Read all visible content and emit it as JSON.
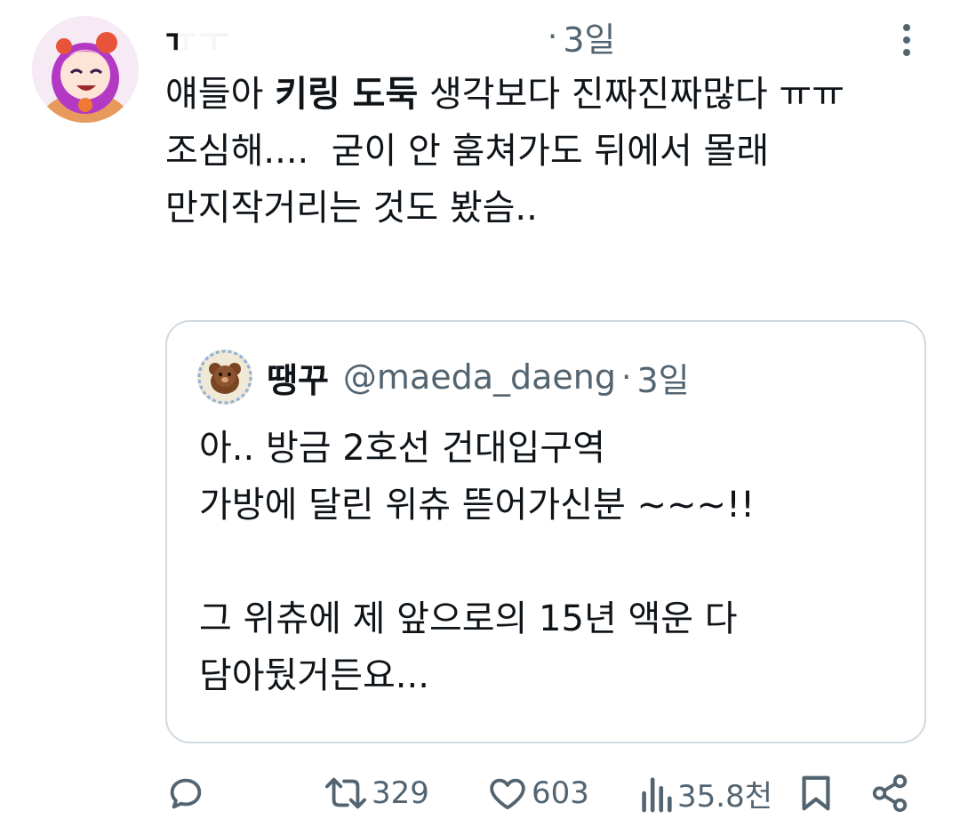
{
  "tweet": {
    "display_name": "ㅠㅜ",
    "dot": "·",
    "time": "3일",
    "text_lines": [
      {
        "pre": "얘들아 ",
        "strong": "키링 도둑",
        "post": " 생각보다 진짜진짜많다 ㅠㅠ"
      },
      {
        "pre": "조심해....  굳이 안 훔쳐가도 뒤에서 몰래 만지작거리는 것도 봤슴..",
        "strong": "",
        "post": ""
      }
    ]
  },
  "quote": {
    "name": "땡꾸",
    "handle": "@maeda_daeng",
    "dot": "·",
    "time": "3일",
    "text": "아.. 방금 2호선 건대입구역\n가방에 달린 위츄 뜯어가신분 ~~~!!\n\n그 위츄에 제 앞으로의 15년 액운 다\n담아뒀거든요..."
  },
  "actions": {
    "reply": {
      "icon": "reply-icon",
      "count": ""
    },
    "retweet": {
      "icon": "retweet-icon",
      "count": "329"
    },
    "like": {
      "icon": "heart-icon",
      "count": "603"
    },
    "views": {
      "icon": "views-icon",
      "count": "35.8천"
    },
    "bookmark": {
      "icon": "bookmark-icon"
    },
    "share": {
      "icon": "share-icon"
    }
  },
  "colors": {
    "text": "#0f1419",
    "secondary": "#536471",
    "border": "#cfd9de",
    "avatar_accent": "#c648d8"
  }
}
